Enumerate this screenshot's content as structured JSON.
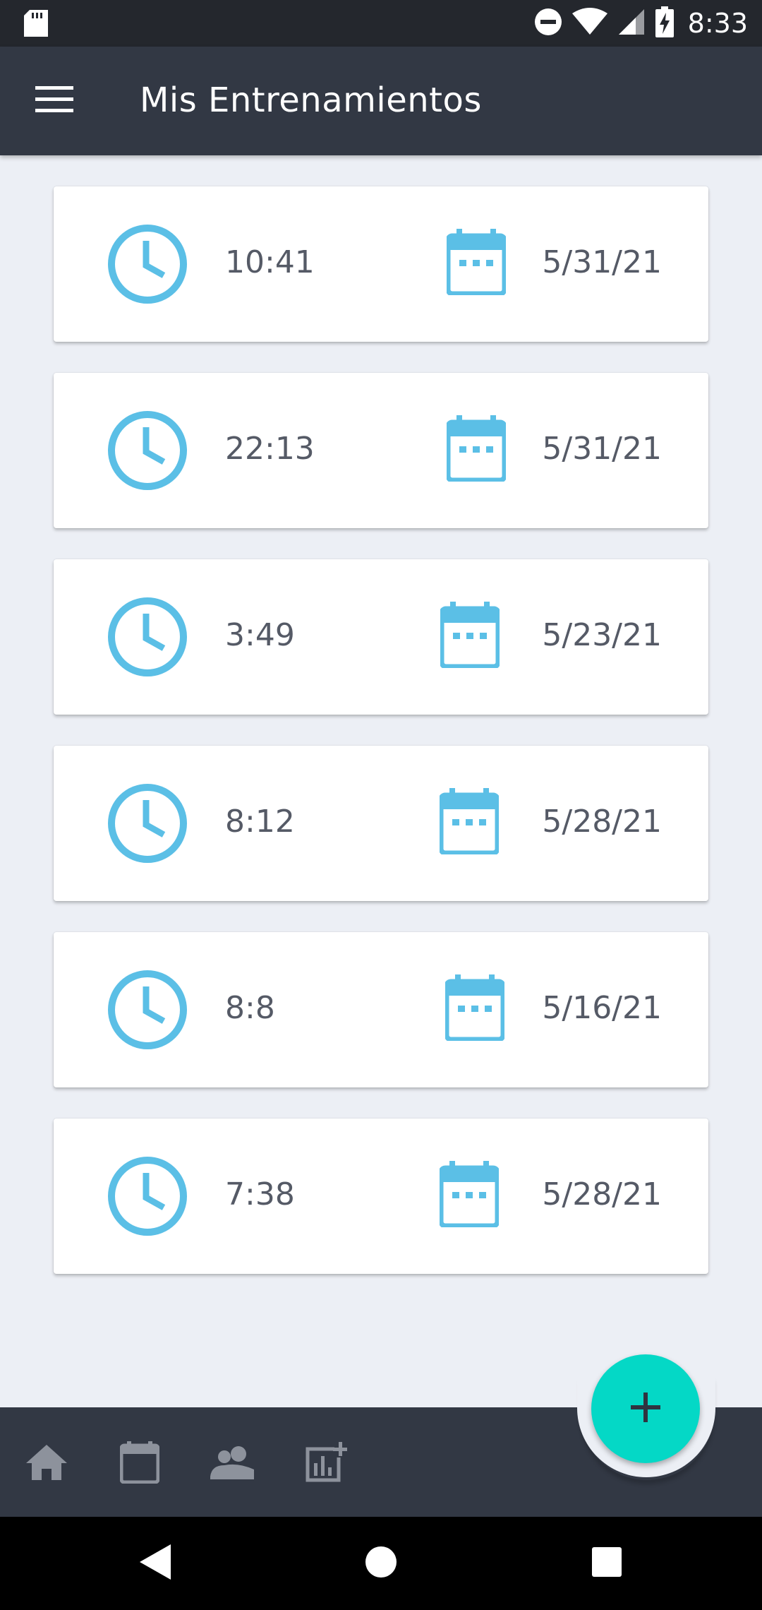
{
  "status_bar": {
    "time": "8:33",
    "icons": [
      "sd-card-icon",
      "do-not-disturb-icon",
      "wifi-icon",
      "signal-icon",
      "battery-charging-icon"
    ]
  },
  "app_bar": {
    "title": "Mis Entrenamientos",
    "menu_icon": "menu-icon"
  },
  "workouts": [
    {
      "duration": "10:41",
      "date": "5/31/21"
    },
    {
      "duration": "22:13",
      "date": "5/31/21"
    },
    {
      "duration": "3:49",
      "date": "5/23/21"
    },
    {
      "duration": "8:12",
      "date": "5/28/21"
    },
    {
      "duration": "8:8",
      "date": "5/16/21"
    },
    {
      "duration": "7:38",
      "date": "5/28/21"
    }
  ],
  "bottom_nav": {
    "items": [
      "home-icon",
      "calendar-icon",
      "people-icon",
      "add-chart-icon"
    ],
    "fab_icon": "plus-icon"
  },
  "system_nav": [
    "back-icon",
    "home-circle-icon",
    "recents-icon"
  ],
  "colors": {
    "accent": "#5bbfe6",
    "fab": "#04d8c6",
    "app_bar": "#323844",
    "background": "#eceff5"
  }
}
